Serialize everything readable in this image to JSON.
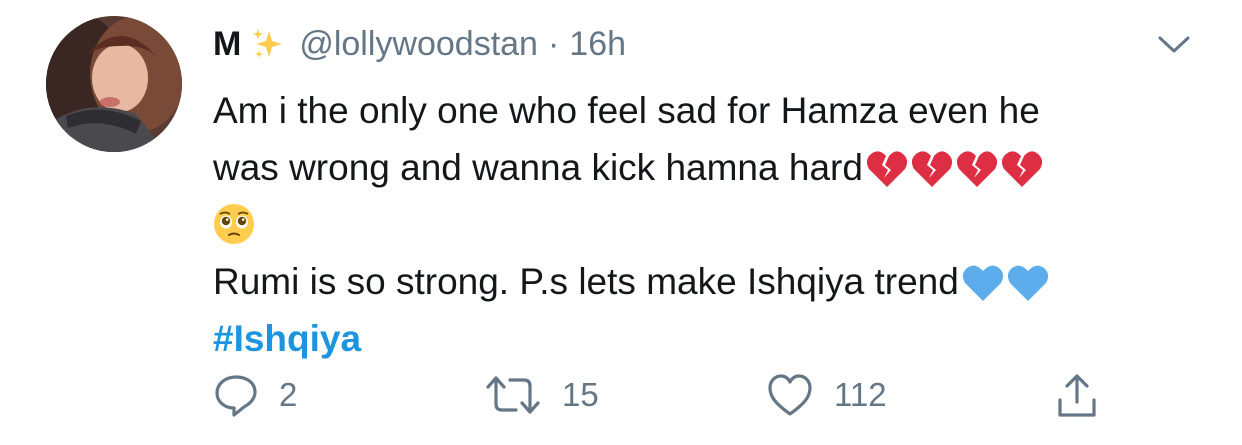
{
  "tweet": {
    "author_name": "M",
    "author_handle": "@lollywoodstan",
    "separator": "·",
    "time_ago": "16h",
    "lines": [
      "Am i the only one who feel sad for Hamza even he",
      "was wrong and wanna kick hamna hard",
      "",
      "Rumi is so strong. P.s lets make Ishqiya trend"
    ],
    "hashtag": "#Ishqiya"
  },
  "actions": {
    "reply_count": "2",
    "retweet_count": "15",
    "like_count": "112"
  },
  "icons": [
    "sparkles-icon",
    "chevron-down-icon",
    "broken-heart-icon",
    "pleading-face-icon",
    "blue-heart-icon",
    "reply-icon",
    "retweet-icon",
    "like-icon",
    "share-icon"
  ],
  "colors": {
    "text": "#14171a",
    "secondary": "#657786",
    "link": "#1b95e0",
    "broken_heart": "#dd2e44",
    "blue_heart": "#5dadec",
    "sparkle": "#ffcc4d"
  }
}
